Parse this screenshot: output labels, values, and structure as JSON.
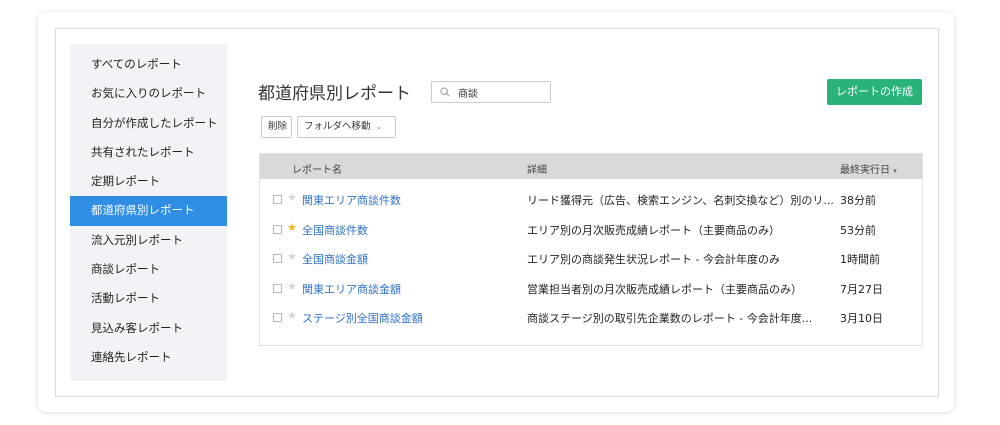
{
  "sidebar": {
    "items": [
      {
        "label": "すべてのレポート"
      },
      {
        "label": "お気に入りのレポート"
      },
      {
        "label": "自分が作成したレポート"
      },
      {
        "label": "共有されたレポート"
      },
      {
        "label": "定期レポート"
      },
      {
        "label": "都道府県別レポート",
        "active": true
      },
      {
        "label": "流入元別レポート"
      },
      {
        "label": "商談レポート"
      },
      {
        "label": "活動レポート"
      },
      {
        "label": "見込み客レポート"
      },
      {
        "label": "連絡先レポート"
      }
    ]
  },
  "header": {
    "title": "都道府県別レポート",
    "search_value": "商談",
    "create_label": "レポートの作成"
  },
  "toolbar": {
    "delete_label": "削除",
    "move_label": "フォルダへ移動"
  },
  "table": {
    "columns": [
      "レポート名",
      "詳細",
      "最終実行日"
    ],
    "sort_indicator": "▾",
    "rows": [
      {
        "name": "関東エリア商談件数",
        "detail": "リード獲得元（広告、検索エンジン、名刺交換など）別のリ...",
        "last_run": "38分前",
        "favorite": false
      },
      {
        "name": "全国商談件数",
        "detail": "エリア別の月次販売成績レポート（主要商品のみ）",
        "last_run": "53分前",
        "favorite": true
      },
      {
        "name": "全国商談金額",
        "detail": "エリア別の商談発生状況レポート - 今会計年度のみ",
        "last_run": "1時間前",
        "favorite": false
      },
      {
        "name": "関東エリア商談金額",
        "detail": "営業担当者別の月次販売成績レポート（主要商品のみ）",
        "last_run": "7月27日",
        "favorite": false
      },
      {
        "name": "ステージ別全国商談金額",
        "detail": "商談ステージ別の取引先企業数のレポート - 今会計年度...",
        "last_run": "3月10日",
        "favorite": false
      }
    ]
  },
  "colors": {
    "accent": "#2f8de4",
    "create_button": "#2ab27b",
    "link": "#2f70c7",
    "star_favorite": "#f2b51b"
  }
}
